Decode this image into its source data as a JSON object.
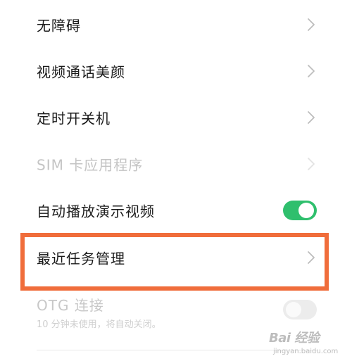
{
  "settings_list": {
    "items": [
      {
        "label": "无障碍",
        "control": "chevron",
        "enabled": true
      },
      {
        "label": "视频通话美颜",
        "control": "chevron",
        "enabled": true
      },
      {
        "label": "定时开关机",
        "control": "chevron",
        "enabled": true
      },
      {
        "label": "SIM 卡应用程序",
        "control": "chevron",
        "enabled": false
      },
      {
        "label": "自动播放演示视频",
        "control": "toggle",
        "toggle_state": "on",
        "enabled": true
      },
      {
        "label": "最近任务管理",
        "control": "chevron",
        "enabled": true,
        "highlighted": true
      }
    ],
    "otg": {
      "label": "OTG 连接",
      "subtitle": "10 分钟未使用，将自动关闭。",
      "toggle_state": "off",
      "enabled": false
    }
  },
  "watermark": {
    "logo": "Bai 经验",
    "url": "jingyan.baidu.com"
  },
  "colors": {
    "toggle_on": "#2fbf6d",
    "toggle_off": "#ececec",
    "highlight_border": "#f06d3b",
    "chevron": "#bdbdbd",
    "text_primary": "#1a1a1a",
    "text_disabled": "#c4c4c4"
  },
  "icons": {
    "chevron": "chevron-right-icon",
    "watermark_paw": "paw-icon"
  }
}
